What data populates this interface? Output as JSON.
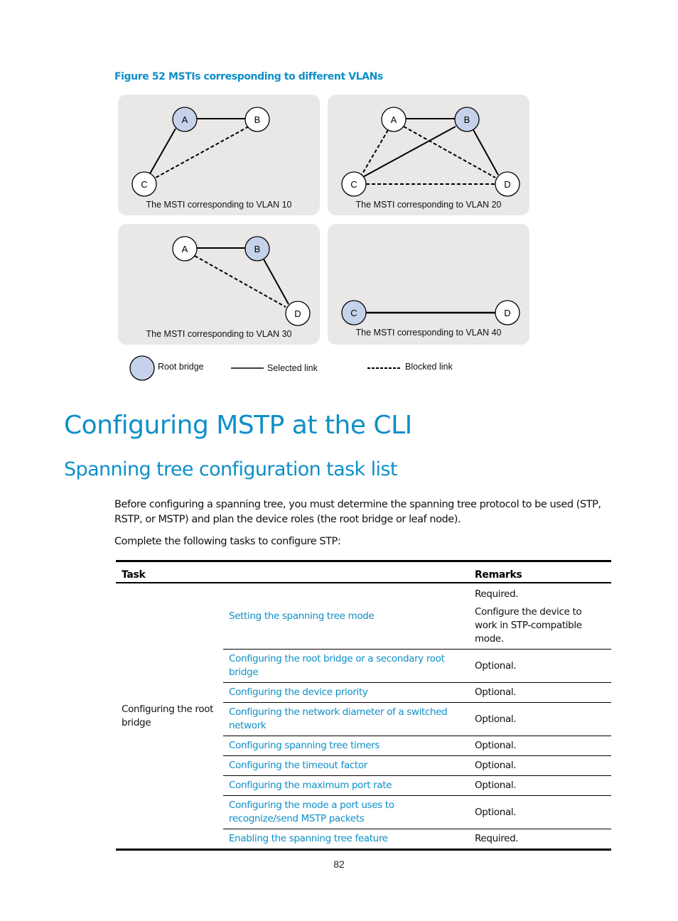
{
  "figure": {
    "caption": "Figure 52 MSTIs corresponding to different VLANs",
    "colors": {
      "root_bridge_fill": "#c6d1ea",
      "node_fill": "#ffffff",
      "panel_bg": "#e9e8e7",
      "accent": "#0e8fc8"
    },
    "panels": [
      {
        "label": "The MSTI corresponding to VLAN 10",
        "nodes": [
          {
            "id": "A",
            "root": true
          },
          {
            "id": "B",
            "root": false
          },
          {
            "id": "C",
            "root": false
          }
        ],
        "links": [
          {
            "from": "A",
            "to": "B",
            "state": "selected"
          },
          {
            "from": "A",
            "to": "C",
            "state": "selected"
          },
          {
            "from": "B",
            "to": "C",
            "state": "blocked"
          }
        ]
      },
      {
        "label": "The MSTI corresponding to VLAN 20",
        "nodes": [
          {
            "id": "A",
            "root": false
          },
          {
            "id": "B",
            "root": true
          },
          {
            "id": "C",
            "root": false
          },
          {
            "id": "D",
            "root": false
          }
        ],
        "links": [
          {
            "from": "A",
            "to": "B",
            "state": "selected"
          },
          {
            "from": "B",
            "to": "C",
            "state": "selected"
          },
          {
            "from": "B",
            "to": "D",
            "state": "selected"
          },
          {
            "from": "A",
            "to": "C",
            "state": "blocked"
          },
          {
            "from": "A",
            "to": "D",
            "state": "blocked"
          },
          {
            "from": "C",
            "to": "D",
            "state": "blocked"
          }
        ]
      },
      {
        "label": "The MSTI corresponding to VLAN 30",
        "nodes": [
          {
            "id": "A",
            "root": false
          },
          {
            "id": "B",
            "root": true
          },
          {
            "id": "D",
            "root": false
          }
        ],
        "links": [
          {
            "from": "A",
            "to": "B",
            "state": "selected"
          },
          {
            "from": "B",
            "to": "D",
            "state": "selected"
          },
          {
            "from": "A",
            "to": "D",
            "state": "blocked"
          }
        ]
      },
      {
        "label": "The MSTI corresponding to VLAN 40",
        "nodes": [
          {
            "id": "C",
            "root": true
          },
          {
            "id": "D",
            "root": false
          }
        ],
        "links": [
          {
            "from": "C",
            "to": "D",
            "state": "selected"
          }
        ]
      }
    ],
    "legend": {
      "root_bridge": "Root bridge",
      "selected_link": "Selected link",
      "blocked_link": "Blocked link"
    }
  },
  "headings": {
    "chapter": "Configuring MSTP at the CLI",
    "section": "Spanning tree configuration task list"
  },
  "paragraphs": {
    "intro": "Before configuring a spanning tree, you must determine the spanning tree protocol to be used (STP, RSTP, or MSTP) and plan the device roles (the root bridge or leaf node).",
    "lead": "Complete the following tasks to configure STP:"
  },
  "table": {
    "headers": {
      "task": "Task",
      "remarks": "Remarks"
    },
    "group_label": "Configuring the root bridge",
    "rows": [
      {
        "task": "Setting the spanning tree mode",
        "remarks": [
          "Required.",
          "Configure the device to work in STP-compatible mode."
        ]
      },
      {
        "task": "Configuring the root bridge or a secondary root bridge",
        "remarks": [
          "Optional."
        ]
      },
      {
        "task": "Configuring the device priority",
        "remarks": [
          "Optional."
        ]
      },
      {
        "task": "Configuring the network diameter of a switched network",
        "remarks": [
          "Optional."
        ]
      },
      {
        "task": "Configuring spanning tree timers",
        "remarks": [
          "Optional."
        ]
      },
      {
        "task": "Configuring the timeout factor",
        "remarks": [
          "Optional."
        ]
      },
      {
        "task": "Configuring the maximum port rate",
        "remarks": [
          "Optional."
        ]
      },
      {
        "task": "Configuring the mode a port uses to recognize/send MSTP packets",
        "remarks": [
          "Optional."
        ]
      },
      {
        "task": "Enabling the spanning tree feature",
        "remarks": [
          "Required."
        ]
      }
    ]
  },
  "page_number": "82"
}
